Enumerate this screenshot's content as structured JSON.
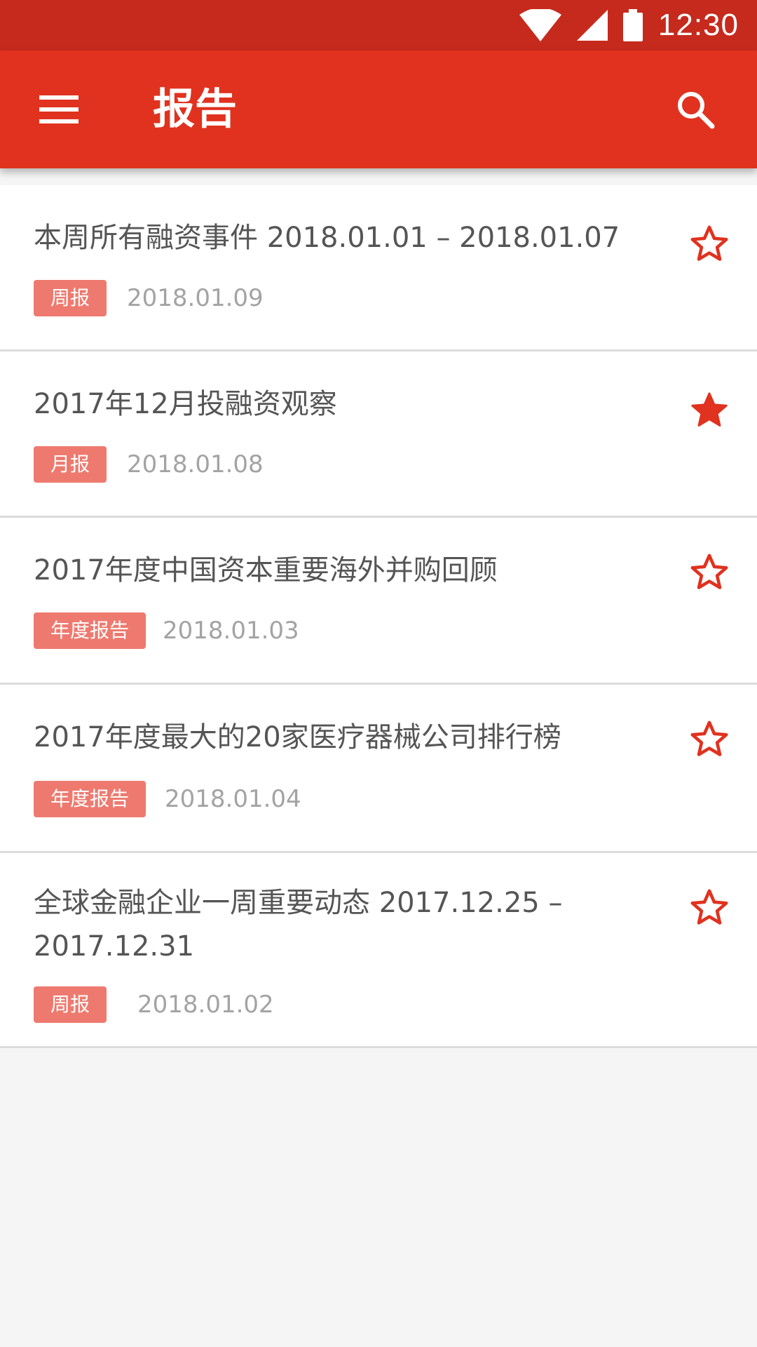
{
  "status_bar": {
    "time": "12:30",
    "icons": [
      "wifi-icon",
      "cell-signal-icon",
      "battery-icon"
    ]
  },
  "app_bar": {
    "title": "报告",
    "menu_icon": "menu-icon",
    "search_icon": "search-icon"
  },
  "colors": {
    "status_bar": "#c62a1d",
    "app_bar": "#e0321f",
    "tag": "#ee7a6f",
    "star": "#e0321f"
  },
  "reports": [
    {
      "title": "本周所有融资事件 2018.01.01 – 2018.01.07",
      "tag": "周报",
      "date": "2018.01.09",
      "starred": false
    },
    {
      "title": "2017年12月投融资观察",
      "tag": "月报",
      "date": "2018.01.08",
      "starred": true
    },
    {
      "title": "2017年度中国资本重要海外并购回顾",
      "tag": "年度报告",
      "date": "2018.01.03",
      "starred": false
    },
    {
      "title": "2017年度最大的20家医疗器械公司排行榜",
      "tag": "年度报告",
      "date": "2018.01.04",
      "starred": false
    },
    {
      "title": "全球金融企业一周重要动态 2017.12.25 – 2017.12.31",
      "tag": "周报",
      "date": "2018.01.02",
      "starred": false
    }
  ]
}
